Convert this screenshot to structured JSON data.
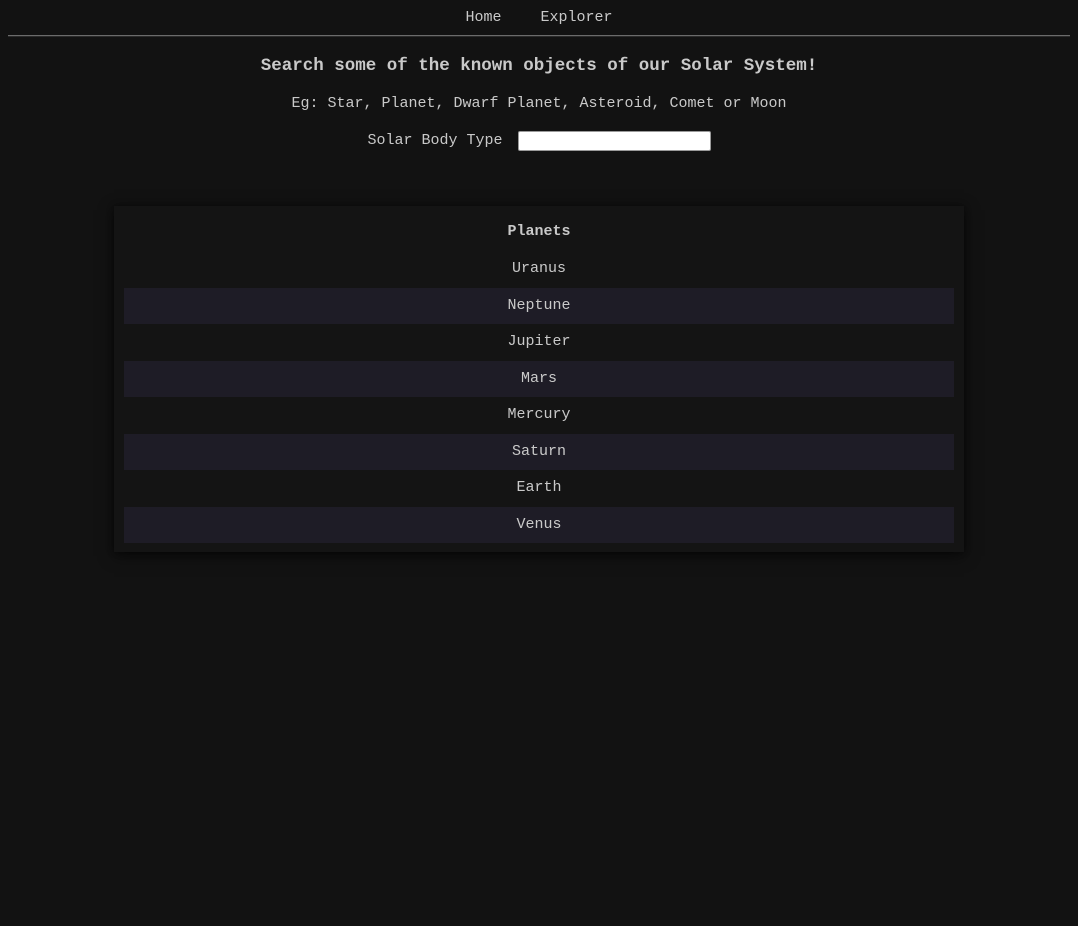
{
  "nav": {
    "links": [
      {
        "label": "Home"
      },
      {
        "label": "Explorer"
      }
    ]
  },
  "main": {
    "headline": "Search some of the known objects of our Solar System!",
    "hint": "Eg: Star, Planet, Dwarf Planet, Asteroid, Comet or Moon",
    "search": {
      "label": "Solar Body Type",
      "value": "",
      "placeholder": ""
    }
  },
  "results": {
    "title": "Planets",
    "items": [
      {
        "name": "Uranus"
      },
      {
        "name": "Neptune"
      },
      {
        "name": "Jupiter"
      },
      {
        "name": "Mars"
      },
      {
        "name": "Mercury"
      },
      {
        "name": "Saturn"
      },
      {
        "name": "Earth"
      },
      {
        "name": "Venus"
      }
    ]
  },
  "colors": {
    "background": "#121212",
    "text": "#c9c9c9",
    "row_alt": "#1e1c26"
  }
}
